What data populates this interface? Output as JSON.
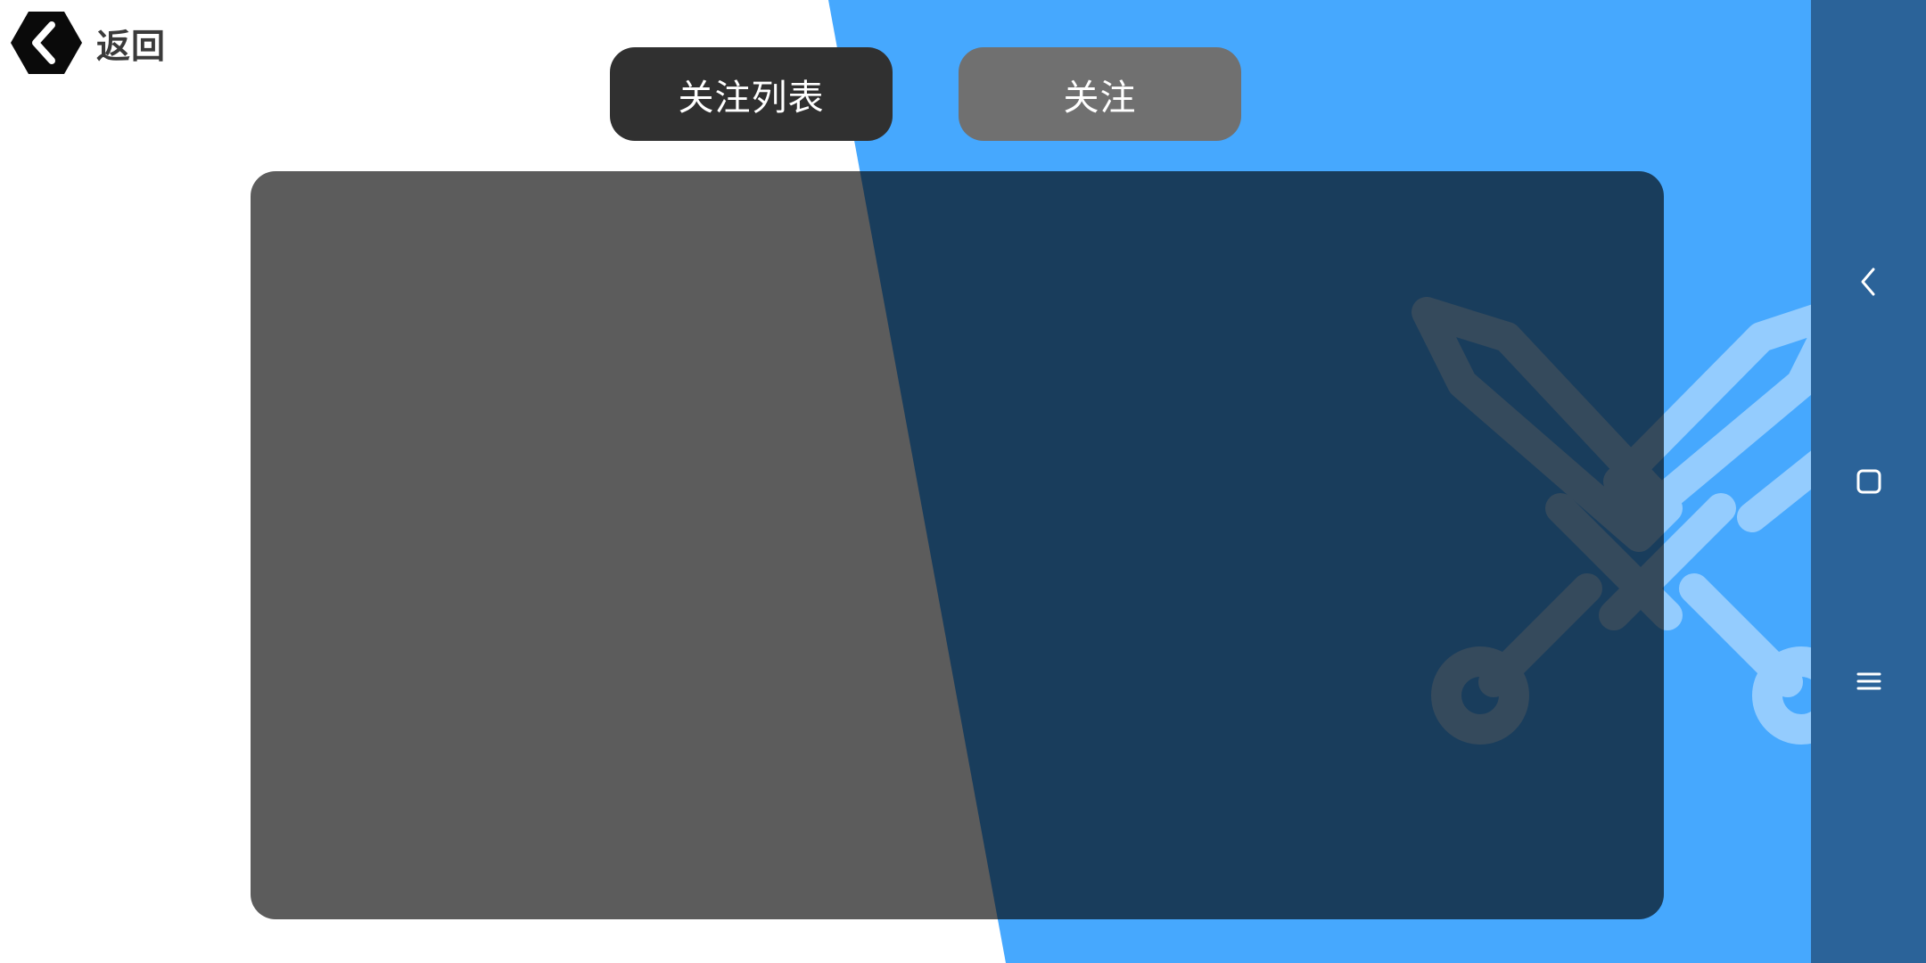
{
  "header": {
    "back_label": "返回",
    "back_icon": "hexagon-chevron-left-icon"
  },
  "tabs": [
    {
      "label": "关注列表",
      "state": "selected"
    },
    {
      "label": "关注",
      "state": "unselected"
    }
  ],
  "nav_bar": {
    "buttons": [
      {
        "icon": "nav-back-icon"
      },
      {
        "icon": "nav-home-icon"
      },
      {
        "icon": "nav-menu-icon"
      }
    ]
  },
  "decoration": {
    "icon": "crossed-swords-icon"
  },
  "colors": {
    "accent_blue": "#46a8fe",
    "nav_bar": "#2b6399",
    "selected_tab": "#303030",
    "unselected_tab": "#707070",
    "panel": "rgba(0,0,0,0.64)"
  }
}
